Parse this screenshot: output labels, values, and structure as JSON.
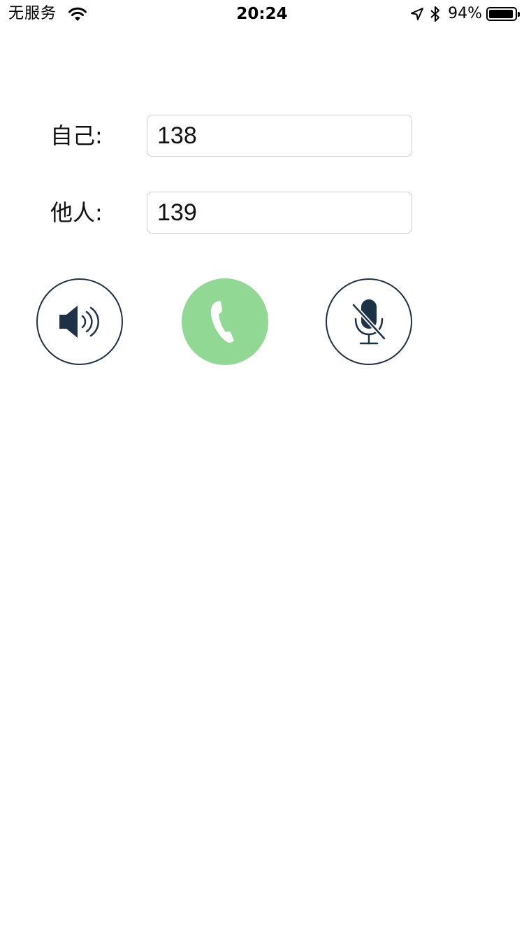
{
  "status_bar": {
    "carrier": "无服务",
    "time": "20:24",
    "battery_percent_label": "94%",
    "battery_level": 0.94,
    "icons": [
      "wifi-icon",
      "location-arrow-icon",
      "bluetooth-icon",
      "battery-icon"
    ]
  },
  "form": {
    "self_label": "自己:",
    "self_value": "138",
    "other_label": "他人:",
    "other_value": "139"
  },
  "controls": {
    "icons": [
      "speaker-icon",
      "phone-icon",
      "mic-muted-icon"
    ]
  },
  "colors": {
    "call_button": "#91d894",
    "icon_dark": "#1e3247"
  }
}
